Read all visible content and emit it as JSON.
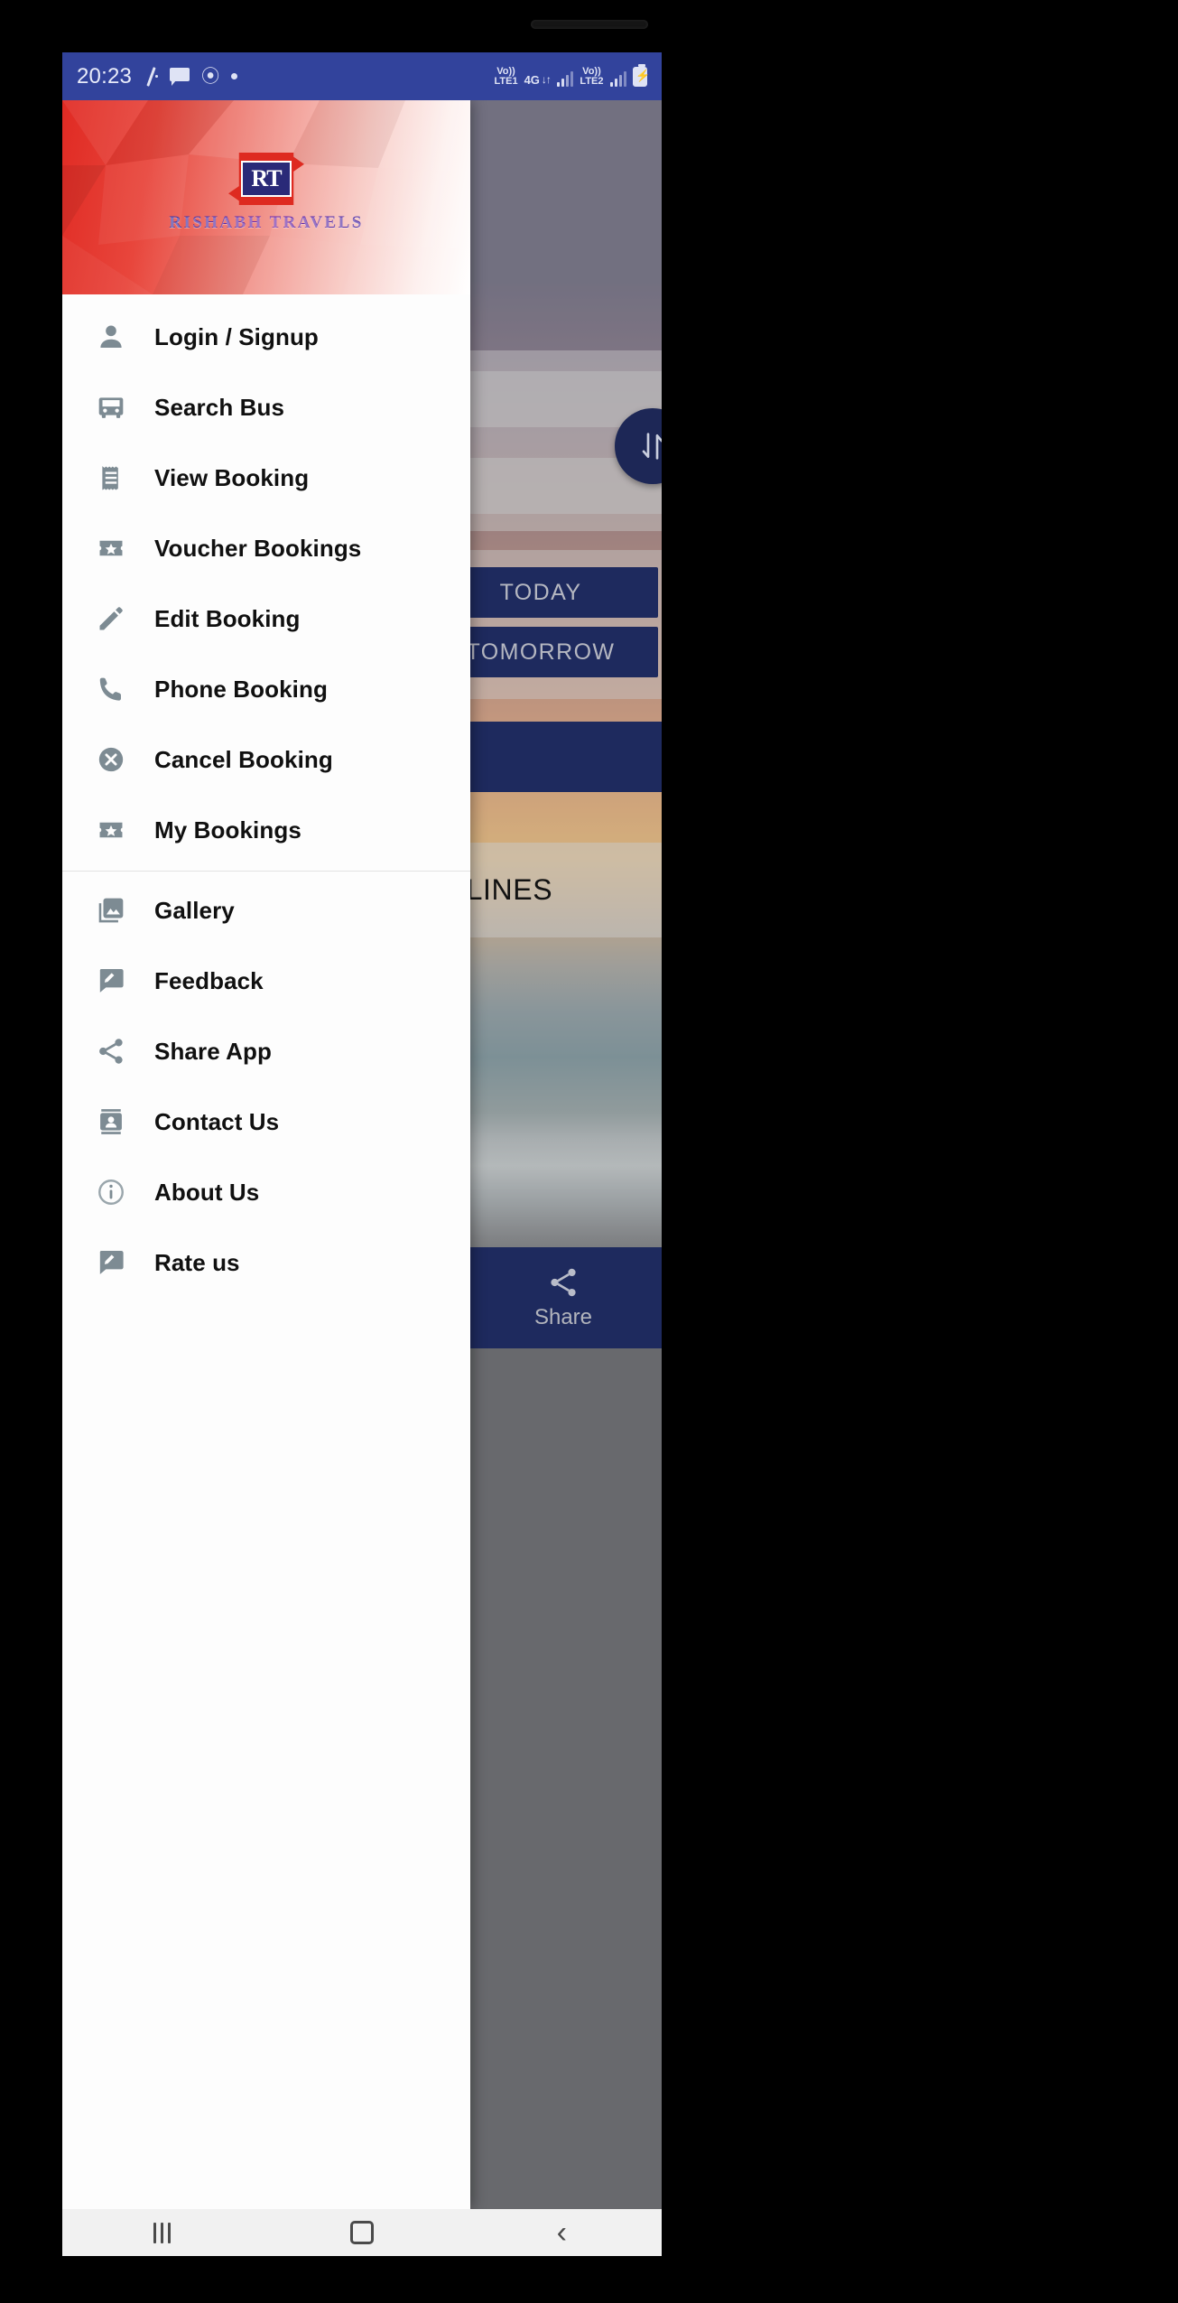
{
  "status_bar": {
    "time": "20:23",
    "left_icons": [
      "silent-slash-icon",
      "chat-bubble-icon",
      "swirl-app-icon",
      "dot-icon"
    ],
    "volte1_label": "Vo))",
    "volte1_sub": "LTE1",
    "network_label": "4G",
    "network_arrows": "↓↑",
    "volte2_label": "Vo))",
    "volte2_sub": "LTE2",
    "battery": "charging"
  },
  "drawer": {
    "brand": {
      "logo_text": "RT",
      "name": "RISHABH TRAVELS"
    },
    "primary_items": [
      {
        "label": "Login / Signup",
        "icon": "person-icon"
      },
      {
        "label": "Search Bus",
        "icon": "bus-icon"
      },
      {
        "label": "View Booking",
        "icon": "receipt-icon"
      },
      {
        "label": "Voucher Bookings",
        "icon": "ticket-star-icon"
      },
      {
        "label": "Edit Booking",
        "icon": "pencil-icon"
      },
      {
        "label": "Phone Booking",
        "icon": "phone-icon"
      },
      {
        "label": "Cancel Booking",
        "icon": "cancel-circle-icon"
      },
      {
        "label": "My Bookings",
        "icon": "ticket-star-icon"
      }
    ],
    "secondary_items": [
      {
        "label": "Gallery",
        "icon": "photo-library-icon"
      },
      {
        "label": "Feedback",
        "icon": "rate-review-icon"
      },
      {
        "label": "Share App",
        "icon": "share-icon"
      },
      {
        "label": "Contact Us",
        "icon": "contact-page-icon"
      },
      {
        "label": "About Us",
        "icon": "info-circle-icon"
      },
      {
        "label": "Rate us",
        "icon": "rate-review-icon"
      }
    ]
  },
  "background_app": {
    "swap_button": "swap-vertical-icon",
    "today_label": "TODAY",
    "tomorrow_label": "TOMORROW",
    "guidelines_label": "DELINES",
    "share_label": "Share",
    "share_icon": "share-icon"
  },
  "nav_bar": {
    "recents": "recents-button",
    "home": "home-button",
    "back": "back-button"
  },
  "colors": {
    "status_bar": "#32439c",
    "brand_red": "#de2a20",
    "brand_navy": "#2a2a78",
    "accent_navy": "#1e2a5e",
    "icon_gray": "#7d8b93"
  }
}
